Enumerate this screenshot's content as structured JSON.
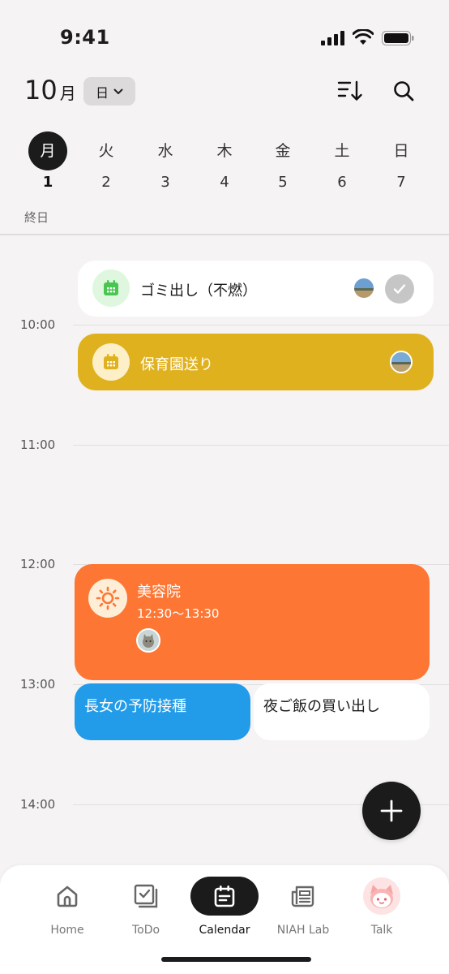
{
  "status": {
    "time": "9:41"
  },
  "header": {
    "month_num": "10",
    "month_unit": "月",
    "view_label": "日"
  },
  "week": [
    {
      "dow": "月",
      "num": "1",
      "active": true
    },
    {
      "dow": "火",
      "num": "2"
    },
    {
      "dow": "水",
      "num": "3"
    },
    {
      "dow": "木",
      "num": "4"
    },
    {
      "dow": "金",
      "num": "5"
    },
    {
      "dow": "土",
      "num": "6"
    },
    {
      "dow": "日",
      "num": "7"
    }
  ],
  "allday_label": "終日",
  "hours": [
    "10:00",
    "11:00",
    "12:00",
    "13:00",
    "14:00"
  ],
  "events": {
    "garbage": {
      "title": "ゴミ出し（不燃）"
    },
    "daycare": {
      "title": "保育園送り"
    },
    "salon": {
      "title": "美容院",
      "time": "12:30～13:30"
    },
    "vaccine": {
      "title": "長女の予防接種"
    },
    "shopping": {
      "title": "夜ご飯の買い出し"
    }
  },
  "nav": [
    {
      "label": "Home",
      "icon": "home-icon"
    },
    {
      "label": "ToDo",
      "icon": "todo-icon"
    },
    {
      "label": "Calendar",
      "icon": "calendar-icon",
      "active": true
    },
    {
      "label": "NIAH  Lab",
      "icon": "newspaper-icon"
    },
    {
      "label": "Talk",
      "icon": "mascot-icon"
    }
  ],
  "colors": {
    "accent_dark": "#1b1b1b",
    "yellow_event": "#e0b11f",
    "orange_event": "#fe7633",
    "blue_event": "#229ce9",
    "green_icon": "#48c650"
  }
}
